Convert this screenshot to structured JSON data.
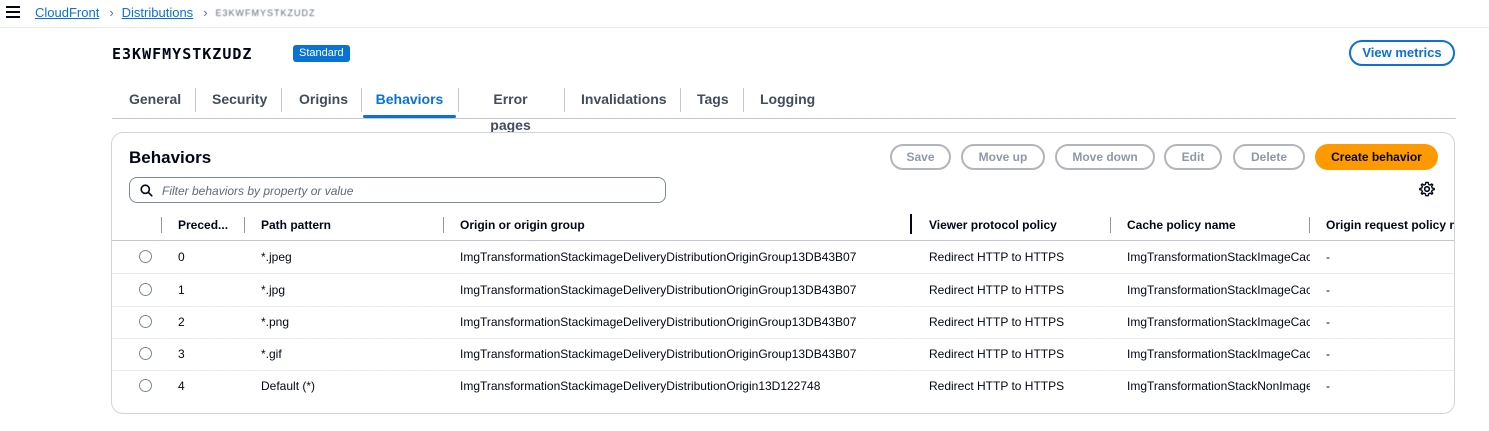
{
  "breadcrumb": {
    "items": [
      "CloudFront",
      "Distributions"
    ],
    "current": "E3KWFMYSTKZUDZ"
  },
  "distribution": {
    "id": "E3KWFMYSTKZUDZ",
    "tier_badge": "Standard",
    "view_metrics_label": "View metrics"
  },
  "tabs": [
    {
      "label": "General"
    },
    {
      "label": "Security"
    },
    {
      "label": "Origins"
    },
    {
      "label": "Behaviors"
    },
    {
      "label": "Error pages"
    },
    {
      "label": "Invalidations"
    },
    {
      "label": "Tags"
    },
    {
      "label": "Logging"
    }
  ],
  "active_tab": "Behaviors",
  "behaviors": {
    "title": "Behaviors",
    "buttons": {
      "save": "Save",
      "move_up": "Move up",
      "move_down": "Move down",
      "edit": "Edit",
      "delete": "Delete",
      "create": "Create behavior"
    },
    "filter_placeholder": "Filter behaviors by property or value",
    "columns": [
      "Preced...",
      "Path pattern",
      "Origin or origin group",
      "Viewer protocol policy",
      "Cache policy name",
      "Origin request policy na"
    ],
    "rows": [
      {
        "precedence": "0",
        "path": "*.jpeg",
        "origin": "ImgTransformationStackimageDeliveryDistributionOriginGroup13DB43B07",
        "viewer": "Redirect HTTP to HTTPS",
        "cache": "ImgTransformationStackImageCac",
        "request": "-"
      },
      {
        "precedence": "1",
        "path": "*.jpg",
        "origin": "ImgTransformationStackimageDeliveryDistributionOriginGroup13DB43B07",
        "viewer": "Redirect HTTP to HTTPS",
        "cache": "ImgTransformationStackImageCac",
        "request": "-"
      },
      {
        "precedence": "2",
        "path": "*.png",
        "origin": "ImgTransformationStackimageDeliveryDistributionOriginGroup13DB43B07",
        "viewer": "Redirect HTTP to HTTPS",
        "cache": "ImgTransformationStackImageCac",
        "request": "-"
      },
      {
        "precedence": "3",
        "path": "*.gif",
        "origin": "ImgTransformationStackimageDeliveryDistributionOriginGroup13DB43B07",
        "viewer": "Redirect HTTP to HTTPS",
        "cache": "ImgTransformationStackImageCac",
        "request": "-"
      },
      {
        "precedence": "4",
        "path": "Default (*)",
        "origin": "ImgTransformationStackimageDeliveryDistributionOrigin13D122748",
        "viewer": "Redirect HTTP to HTTPS",
        "cache": "ImgTransformationStackNonImage",
        "request": "-"
      }
    ]
  },
  "colors": {
    "link": "#0972d3",
    "primary_button": "#ff9900",
    "text": "#000716"
  },
  "icons": [
    "menu-icon",
    "chevron-right-icon",
    "search-icon",
    "gear-icon",
    "radio-icon"
  ]
}
